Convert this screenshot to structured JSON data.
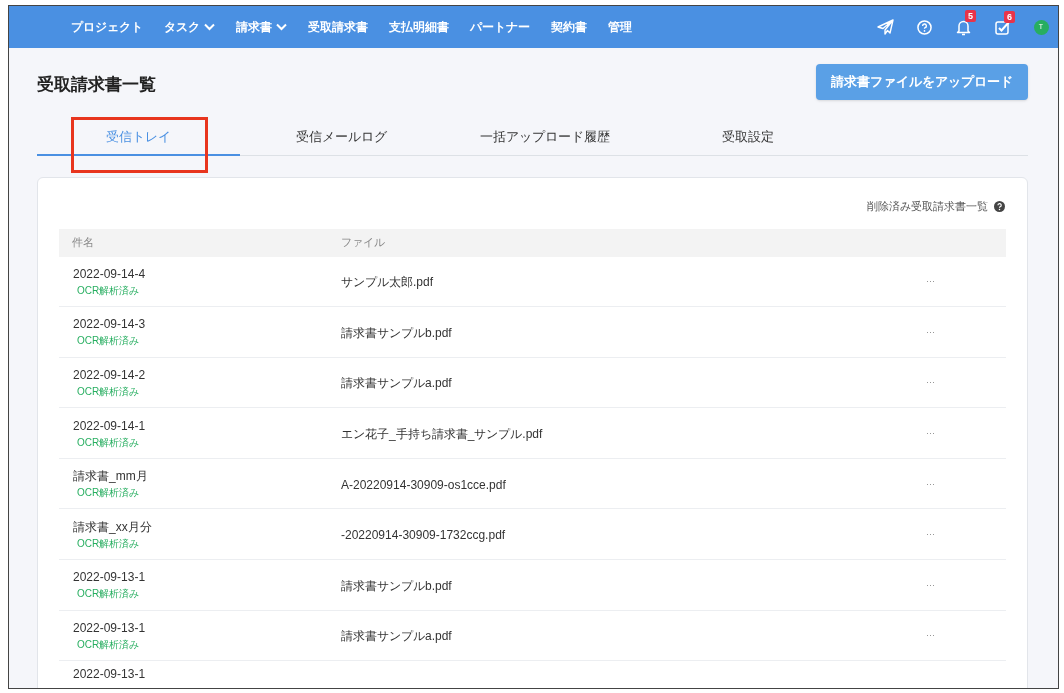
{
  "navbar": {
    "items": [
      {
        "label": "プロジェクト",
        "dropdown": false
      },
      {
        "label": "タスク",
        "dropdown": true
      },
      {
        "label": "請求書",
        "dropdown": true
      },
      {
        "label": "受取請求書",
        "dropdown": false
      },
      {
        "label": "支払明細書",
        "dropdown": false
      },
      {
        "label": "パートナー",
        "dropdown": false
      },
      {
        "label": "契約書",
        "dropdown": false
      },
      {
        "label": "管理",
        "dropdown": false
      }
    ],
    "icons": [
      {
        "kind": "send"
      },
      {
        "kind": "help"
      },
      {
        "kind": "bell",
        "badge": "5"
      },
      {
        "kind": "tasks",
        "badge": "6"
      },
      {
        "kind": "avatar",
        "initial": "T"
      }
    ]
  },
  "page": {
    "title": "受取請求書一覧",
    "upload_button": "請求書ファイルをアップロード"
  },
  "tabs": [
    {
      "label": "受信トレイ",
      "selected": true
    },
    {
      "label": "受信メールログ",
      "selected": false
    },
    {
      "label": "一括アップロード履歴",
      "selected": false
    },
    {
      "label": "受取設定",
      "selected": false
    }
  ],
  "deleted_link": "削除済み受取請求書一覧",
  "table": {
    "columns": [
      "件名",
      "ファイル"
    ],
    "rows": [
      {
        "subject": "2022-09-14-4",
        "status": "OCR解析済み",
        "file": "サンプル太郎.pdf",
        "menu": "···"
      },
      {
        "subject": "2022-09-14-3",
        "status": "OCR解析済み",
        "file": "請求書サンプルb.pdf",
        "menu": "···"
      },
      {
        "subject": "2022-09-14-2",
        "status": "OCR解析済み",
        "file": "請求書サンプルa.pdf",
        "menu": "···"
      },
      {
        "subject": "2022-09-14-1",
        "status": "OCR解析済み",
        "file": "エン花子_手持ち請求書_サンプル.pdf",
        "menu": "···"
      },
      {
        "subject": "請求書_mm月",
        "status": "OCR解析済み",
        "file": "A-20220914-30909-os1cce.pdf",
        "menu": "···"
      },
      {
        "subject": "請求書_xx月分",
        "status": "OCR解析済み",
        "file": "-20220914-30909-1732ccg.pdf",
        "menu": "···"
      },
      {
        "subject": "2022-09-13-1",
        "status": "OCR解析済み",
        "file": "請求書サンプルb.pdf",
        "menu": "···"
      },
      {
        "subject": "2022-09-13-1",
        "status": "OCR解析済み",
        "file": "請求書サンプルa.pdf",
        "menu": "···"
      },
      {
        "subject": "2022-09-13-1"
      }
    ]
  }
}
